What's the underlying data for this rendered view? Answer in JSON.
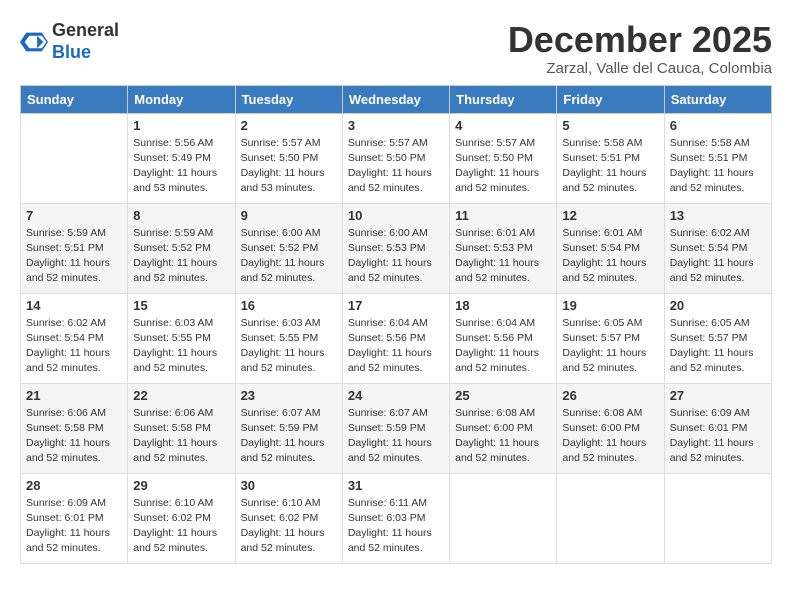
{
  "logo": {
    "general": "General",
    "blue": "Blue"
  },
  "title": "December 2025",
  "location": "Zarzal, Valle del Cauca, Colombia",
  "days_of_week": [
    "Sunday",
    "Monday",
    "Tuesday",
    "Wednesday",
    "Thursday",
    "Friday",
    "Saturday"
  ],
  "weeks": [
    [
      {
        "day": "",
        "info": ""
      },
      {
        "day": "1",
        "info": "Sunrise: 5:56 AM\nSunset: 5:49 PM\nDaylight: 11 hours\nand 53 minutes."
      },
      {
        "day": "2",
        "info": "Sunrise: 5:57 AM\nSunset: 5:50 PM\nDaylight: 11 hours\nand 53 minutes."
      },
      {
        "day": "3",
        "info": "Sunrise: 5:57 AM\nSunset: 5:50 PM\nDaylight: 11 hours\nand 52 minutes."
      },
      {
        "day": "4",
        "info": "Sunrise: 5:57 AM\nSunset: 5:50 PM\nDaylight: 11 hours\nand 52 minutes."
      },
      {
        "day": "5",
        "info": "Sunrise: 5:58 AM\nSunset: 5:51 PM\nDaylight: 11 hours\nand 52 minutes."
      },
      {
        "day": "6",
        "info": "Sunrise: 5:58 AM\nSunset: 5:51 PM\nDaylight: 11 hours\nand 52 minutes."
      }
    ],
    [
      {
        "day": "7",
        "info": "Sunrise: 5:59 AM\nSunset: 5:51 PM\nDaylight: 11 hours\nand 52 minutes."
      },
      {
        "day": "8",
        "info": "Sunrise: 5:59 AM\nSunset: 5:52 PM\nDaylight: 11 hours\nand 52 minutes."
      },
      {
        "day": "9",
        "info": "Sunrise: 6:00 AM\nSunset: 5:52 PM\nDaylight: 11 hours\nand 52 minutes."
      },
      {
        "day": "10",
        "info": "Sunrise: 6:00 AM\nSunset: 5:53 PM\nDaylight: 11 hours\nand 52 minutes."
      },
      {
        "day": "11",
        "info": "Sunrise: 6:01 AM\nSunset: 5:53 PM\nDaylight: 11 hours\nand 52 minutes."
      },
      {
        "day": "12",
        "info": "Sunrise: 6:01 AM\nSunset: 5:54 PM\nDaylight: 11 hours\nand 52 minutes."
      },
      {
        "day": "13",
        "info": "Sunrise: 6:02 AM\nSunset: 5:54 PM\nDaylight: 11 hours\nand 52 minutes."
      }
    ],
    [
      {
        "day": "14",
        "info": "Sunrise: 6:02 AM\nSunset: 5:54 PM\nDaylight: 11 hours\nand 52 minutes."
      },
      {
        "day": "15",
        "info": "Sunrise: 6:03 AM\nSunset: 5:55 PM\nDaylight: 11 hours\nand 52 minutes."
      },
      {
        "day": "16",
        "info": "Sunrise: 6:03 AM\nSunset: 5:55 PM\nDaylight: 11 hours\nand 52 minutes."
      },
      {
        "day": "17",
        "info": "Sunrise: 6:04 AM\nSunset: 5:56 PM\nDaylight: 11 hours\nand 52 minutes."
      },
      {
        "day": "18",
        "info": "Sunrise: 6:04 AM\nSunset: 5:56 PM\nDaylight: 11 hours\nand 52 minutes."
      },
      {
        "day": "19",
        "info": "Sunrise: 6:05 AM\nSunset: 5:57 PM\nDaylight: 11 hours\nand 52 minutes."
      },
      {
        "day": "20",
        "info": "Sunrise: 6:05 AM\nSunset: 5:57 PM\nDaylight: 11 hours\nand 52 minutes."
      }
    ],
    [
      {
        "day": "21",
        "info": "Sunrise: 6:06 AM\nSunset: 5:58 PM\nDaylight: 11 hours\nand 52 minutes."
      },
      {
        "day": "22",
        "info": "Sunrise: 6:06 AM\nSunset: 5:58 PM\nDaylight: 11 hours\nand 52 minutes."
      },
      {
        "day": "23",
        "info": "Sunrise: 6:07 AM\nSunset: 5:59 PM\nDaylight: 11 hours\nand 52 minutes."
      },
      {
        "day": "24",
        "info": "Sunrise: 6:07 AM\nSunset: 5:59 PM\nDaylight: 11 hours\nand 52 minutes."
      },
      {
        "day": "25",
        "info": "Sunrise: 6:08 AM\nSunset: 6:00 PM\nDaylight: 11 hours\nand 52 minutes."
      },
      {
        "day": "26",
        "info": "Sunrise: 6:08 AM\nSunset: 6:00 PM\nDaylight: 11 hours\nand 52 minutes."
      },
      {
        "day": "27",
        "info": "Sunrise: 6:09 AM\nSunset: 6:01 PM\nDaylight: 11 hours\nand 52 minutes."
      }
    ],
    [
      {
        "day": "28",
        "info": "Sunrise: 6:09 AM\nSunset: 6:01 PM\nDaylight: 11 hours\nand 52 minutes."
      },
      {
        "day": "29",
        "info": "Sunrise: 6:10 AM\nSunset: 6:02 PM\nDaylight: 11 hours\nand 52 minutes."
      },
      {
        "day": "30",
        "info": "Sunrise: 6:10 AM\nSunset: 6:02 PM\nDaylight: 11 hours\nand 52 minutes."
      },
      {
        "day": "31",
        "info": "Sunrise: 6:11 AM\nSunset: 6:03 PM\nDaylight: 11 hours\nand 52 minutes."
      },
      {
        "day": "",
        "info": ""
      },
      {
        "day": "",
        "info": ""
      },
      {
        "day": "",
        "info": ""
      }
    ]
  ]
}
